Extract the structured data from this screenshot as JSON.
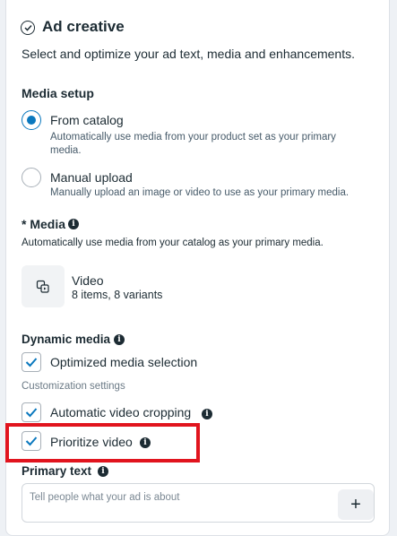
{
  "header": {
    "title": "Ad creative",
    "subtitle": "Select and optimize your ad text, media and enhancements."
  },
  "media_setup": {
    "label": "Media setup",
    "options": [
      {
        "label": "From catalog",
        "description_line1": "Automatically use media from your product set as your primary",
        "description_line2": "media.",
        "selected": true
      },
      {
        "label": "Manual upload",
        "description": "Manually upload an image or video to use as your primary media.",
        "selected": false
      }
    ]
  },
  "media": {
    "label": "* Media",
    "description": "Automatically use media from your catalog as your primary media.",
    "item_title": "Video",
    "item_detail": "8 items, 8 variants"
  },
  "dynamic_media": {
    "label": "Dynamic media",
    "optimized_label": "Optimized media selection",
    "customization_label": "Customization settings",
    "auto_crop_label": "Automatic video cropping",
    "prioritize_label": "Prioritize video"
  },
  "primary_text": {
    "label": "Primary text",
    "placeholder": "Tell people what your ad is about",
    "add_symbol": "+"
  },
  "colors": {
    "accent": "#0a78be",
    "highlight": "#e1141e"
  }
}
